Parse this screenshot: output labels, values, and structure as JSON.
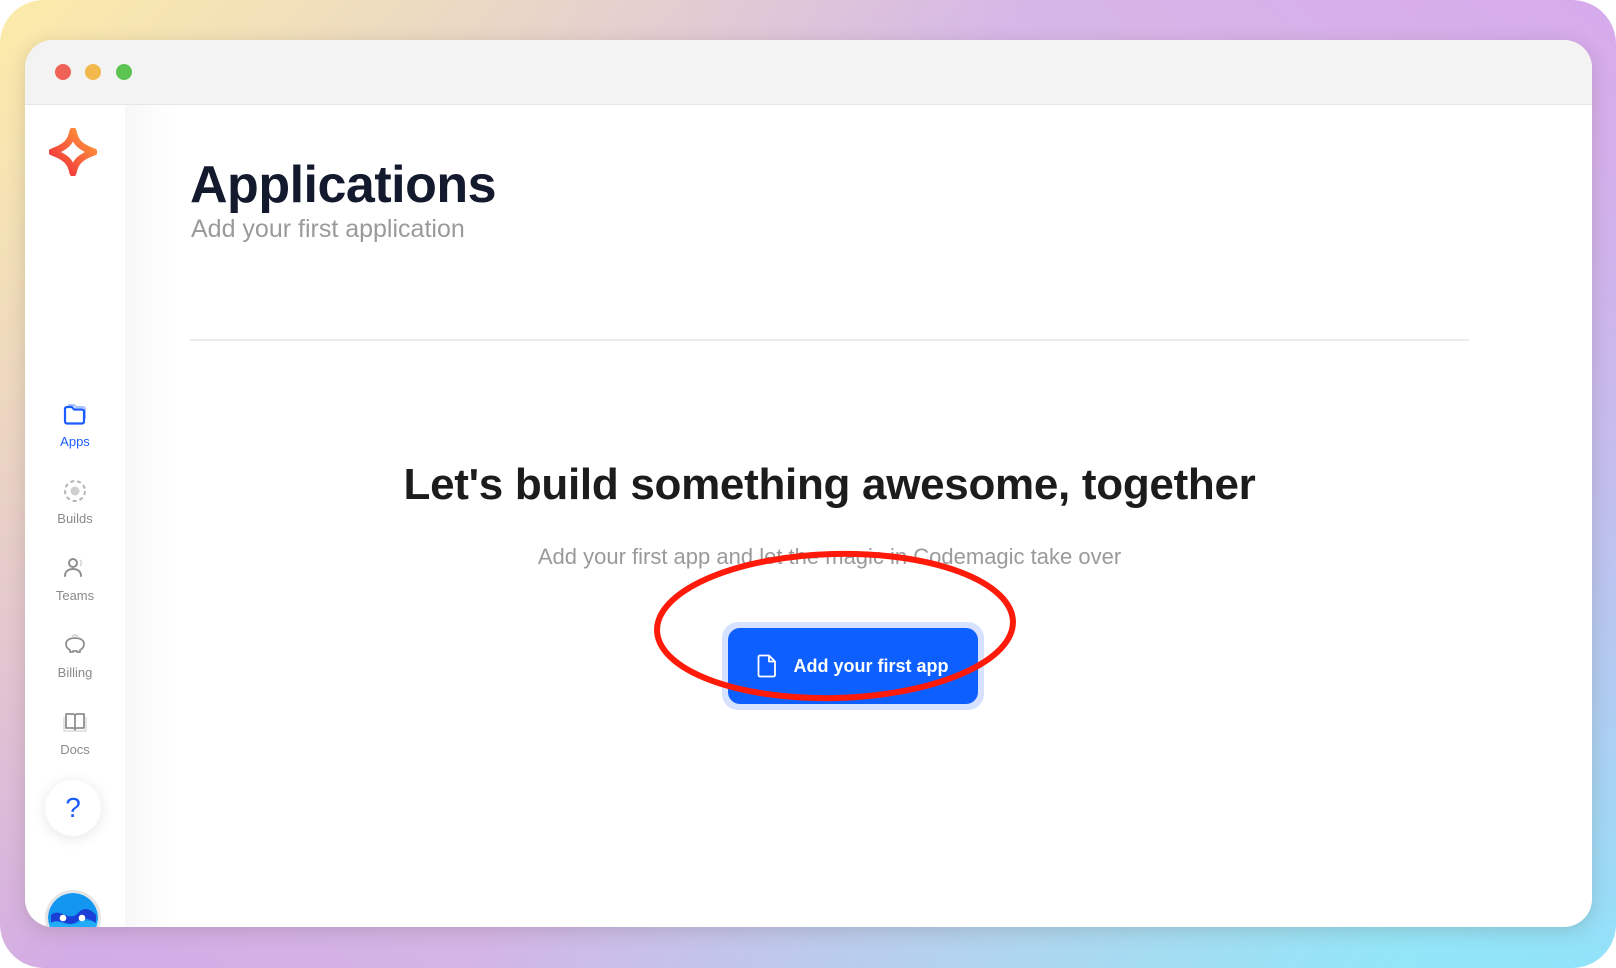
{
  "window": {
    "controls": [
      "close",
      "minimize",
      "maximize"
    ]
  },
  "sidebar": {
    "logo": "codemagic-star-logo",
    "items": [
      {
        "label": "Apps",
        "icon": "folder-icon",
        "active": true
      },
      {
        "label": "Builds",
        "icon": "builds-gear-icon",
        "active": false
      },
      {
        "label": "Teams",
        "icon": "user-icon",
        "active": false
      },
      {
        "label": "Billing",
        "icon": "piggy-bank-icon",
        "active": false
      },
      {
        "label": "Docs",
        "icon": "book-icon",
        "active": false
      }
    ],
    "help_label": "?",
    "avatar": "user-avatar"
  },
  "header": {
    "title": "Applications",
    "subtitle": "Add your first application"
  },
  "empty_state": {
    "title": "Let's build something awesome, together",
    "subtitle": "Add your first app and let the magic in Codemagic take over",
    "cta_label": "Add your first app",
    "cta_icon": "file-icon"
  },
  "colors": {
    "accent": "#0d5fff",
    "accent_halo": "#d6e2ff",
    "annotation": "#ff1a0a",
    "title": "#141a2e",
    "muted": "#9a9a9a"
  },
  "annotation": {
    "type": "ellipse",
    "target": "add-first-app-button"
  }
}
